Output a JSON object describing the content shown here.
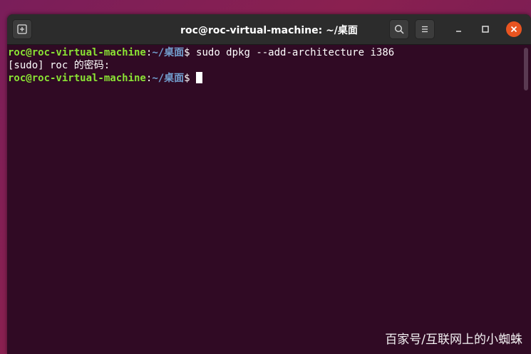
{
  "window": {
    "title": "roc@roc-virtual-machine: ~/桌面"
  },
  "icons": {
    "new_tab": "new-tab-icon",
    "search": "search-icon",
    "menu": "hamburger-menu-icon",
    "minimize": "minimize-icon",
    "maximize": "maximize-icon",
    "close": "close-icon"
  },
  "terminal": {
    "lines": [
      {
        "user": "roc@roc-virtual-machine",
        "path": "~/桌面",
        "cmd": "$ sudo dpkg --add-architecture i386"
      },
      {
        "text": "[sudo] roc 的密码:"
      },
      {
        "user": "roc@roc-virtual-machine",
        "path": "~/桌面",
        "cmd": "$ "
      }
    ]
  },
  "watermark": "百家号/互联网上的小蜘蛛",
  "colors": {
    "terminal_bg": "#300a24",
    "user_color": "#8ae234",
    "path_color": "#729fcf",
    "close_button": "#e95420"
  }
}
